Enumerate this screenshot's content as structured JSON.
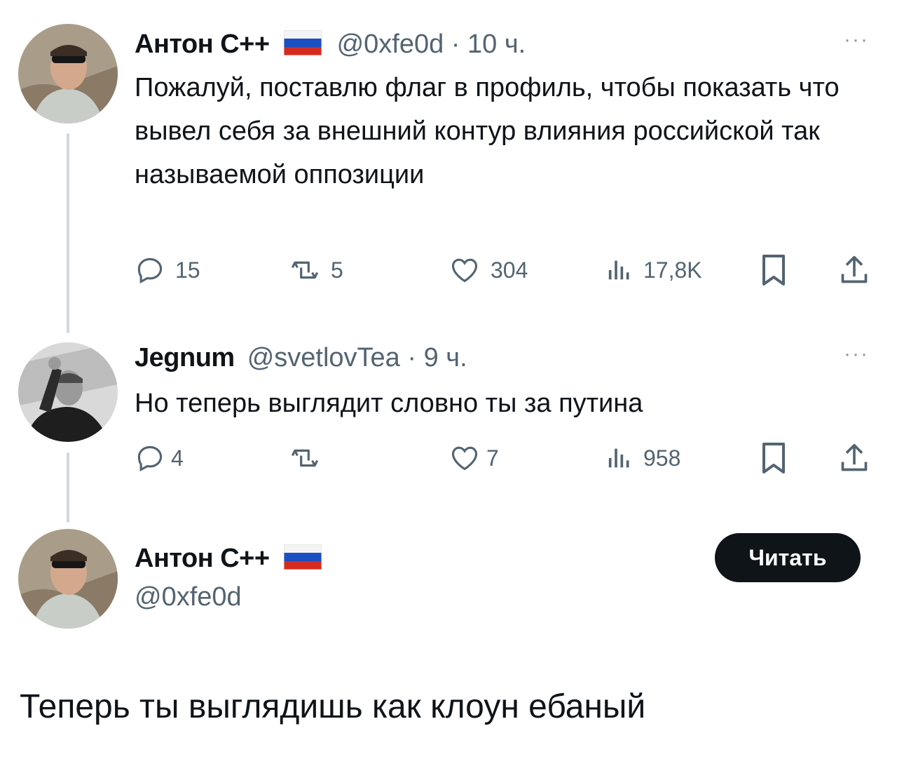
{
  "tweets": [
    {
      "author_name": "Антон С++",
      "handle_time": "@0xfe0d · 10 ч.",
      "text": "Пожалуй, поставлю флаг в профиль, чтобы показать что вывел себя за внешний контур влияния российской так называемой оппозиции",
      "replies": "15",
      "retweets": "5",
      "likes": "304",
      "views": "17,8K"
    },
    {
      "author_name": "Jegnum",
      "handle_time": "@svetlovTea · 9 ч.",
      "text": "Но теперь выглядит словно ты за путина",
      "replies": "4",
      "retweets": "",
      "likes": "7",
      "views": "958"
    }
  ],
  "profile_card": {
    "name": "Антон С++",
    "handle": "@0xfe0d",
    "follow_label": "Читать"
  },
  "caption": "Теперь ты выглядишь как клоун ебаный",
  "more_glyph": "···",
  "colors": {
    "text": "#0f1419",
    "muted": "#536471",
    "line": "#cfd9de"
  }
}
